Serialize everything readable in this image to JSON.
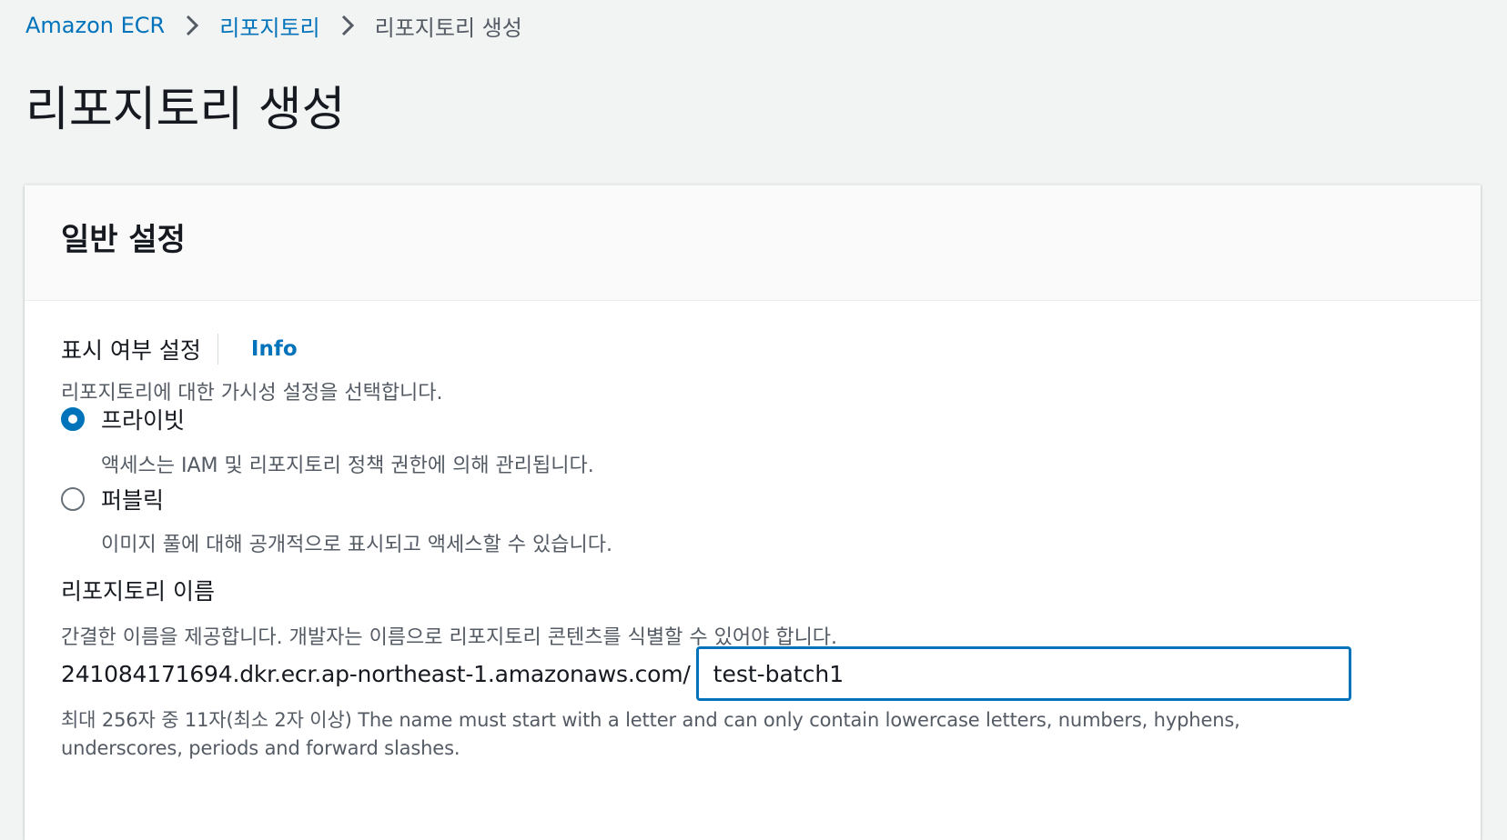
{
  "breadcrumb": {
    "items": [
      {
        "label": "Amazon ECR"
      },
      {
        "label": "리포지토리"
      }
    ],
    "current": "리포지토리 생성"
  },
  "page": {
    "title": "리포지토리 생성"
  },
  "general_settings": {
    "title": "일반 설정",
    "visibility": {
      "label": "표시 여부 설정",
      "info_label": "Info",
      "description": "리포지토리에 대한 가시성 설정을 선택합니다.",
      "options": [
        {
          "label": "프라이빗",
          "description": "액세스는 IAM 및 리포지토리 정책 권한에 의해 관리됩니다.",
          "selected": true
        },
        {
          "label": "퍼블릭",
          "description": "이미지 풀에 대해 공개적으로 표시되고 액세스할 수 있습니다.",
          "selected": false
        }
      ]
    },
    "repo_name": {
      "label": "리포지토리 이름",
      "description": "간결한 이름을 제공합니다. 개발자는 이름으로 리포지토리 콘텐츠를 식별할 수 있어야 합니다.",
      "uri_prefix": "241084171694.dkr.ecr.ap-northeast-1.amazonaws.com/",
      "value": "test-batch1",
      "constraint": "최대 256자 중 11자(최소 2자 이상) The name must start with a letter and can only contain lowercase letters, numbers, hyphens, underscores, periods and forward slashes."
    }
  },
  "colors": {
    "link": "#0073bb",
    "text": "#16191f",
    "secondary_text": "#545b64",
    "background": "#f2f3f3",
    "panel": "#ffffff"
  },
  "icons": {
    "breadcrumb_separator": "chevron-right-icon"
  }
}
